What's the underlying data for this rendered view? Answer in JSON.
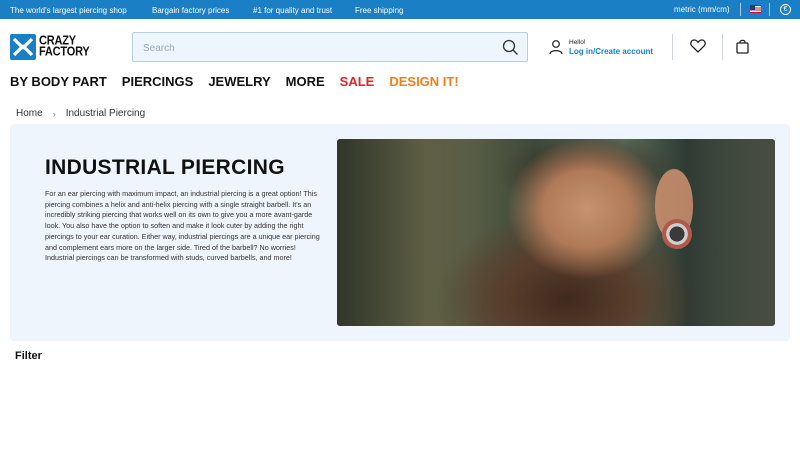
{
  "topbar": {
    "promos": [
      "The world's largest piercing shop",
      "Bargain factory prices",
      "#1 for quality and trust",
      "Free shipping"
    ],
    "units": "metric (mm/cm)",
    "currency_symbol": "€",
    "bg_color": "#1a7fc4"
  },
  "header": {
    "logo_line1": "CRAZY",
    "logo_line2": "FACTORY",
    "search_placeholder": "Search",
    "search_value": "",
    "account_greeting": "Hello!",
    "account_link": "Log in/Create account",
    "icons": [
      "search-icon",
      "user-icon",
      "heart-icon",
      "bag-icon",
      "us-flag-icon",
      "euro-icon"
    ]
  },
  "nav": {
    "items": [
      {
        "label": "BY BODY PART",
        "color": "#111111"
      },
      {
        "label": "PIERCINGS",
        "color": "#111111"
      },
      {
        "label": "JEWELRY",
        "color": "#111111"
      },
      {
        "label": "MORE",
        "color": "#111111"
      },
      {
        "label": "SALE",
        "color": "#e3232c"
      },
      {
        "label": "DESIGN IT!",
        "color": "#f07e1a"
      }
    ]
  },
  "breadcrumb": {
    "home": "Home",
    "separator": "›",
    "current": "Industrial Piercing"
  },
  "hero": {
    "title": "INDUSTRIAL PIERCING",
    "description": "For an ear piercing with maximum impact, an industrial piercing is a great option! This piercing combines a helix and anti-helix piercing with a single straight barbell. It's an incredibly striking piercing that works well on its own to give you a more avant-garde look. You also have the option to soften and make it look cuter by adding the right piercings to your ear curation. Either way, industrial piercings are a unique ear piercing and complement ears more on the larger side. Tired of the barbell? No worries! Industrial piercings can be transformed with studs, curved barbells, and more!",
    "bg_color": "#eef5fc"
  },
  "filter": {
    "label": "Filter"
  }
}
